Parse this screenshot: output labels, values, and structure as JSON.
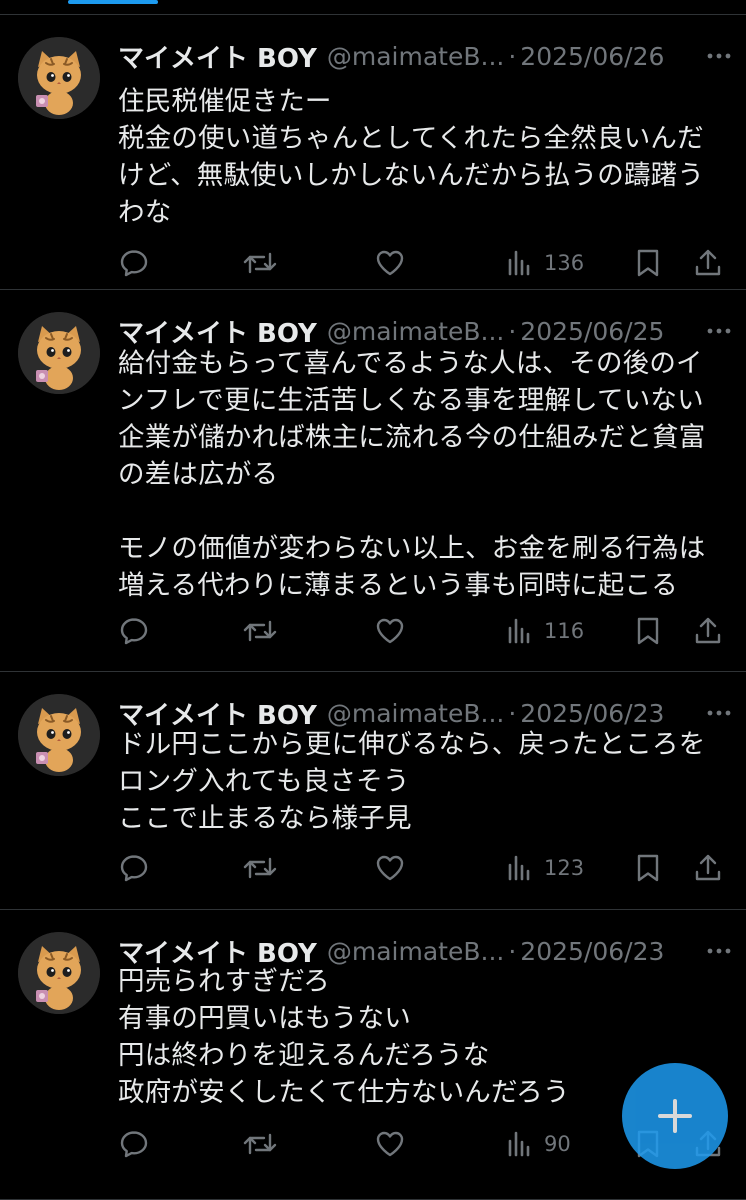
{
  "tweets": [
    {
      "name": "マイメイト BOY",
      "handle": "@maimateB...",
      "separator": "·",
      "date": "2025/06/26",
      "lines": [
        "住民税催促きたー",
        "税金の使い道ちゃんとしてくれたら全然良いんだ",
        "けど、無駄使いしかしないんだから払うの躊躇う",
        "わな"
      ],
      "views": "136"
    },
    {
      "name": "マイメイト BOY",
      "handle": "@maimateB...",
      "separator": "·",
      "date": "2025/06/25",
      "lines": [
        "給付金もらって喜んでるような人は、その後のイ",
        "ンフレで更に生活苦しくなる事を理解していない",
        "企業が儲かれば株主に流れる今の仕組みだと貧富",
        "の差は広がる",
        "",
        "モノの価値が変わらない以上、お金を刷る行為は",
        "増える代わりに薄まるという事も同時に起こる"
      ],
      "views": "116"
    },
    {
      "name": "マイメイト BOY",
      "handle": "@maimateB...",
      "separator": "·",
      "date": "2025/06/23",
      "lines": [
        "ドル円ここから更に伸びるなら、戻ったところを",
        "ロング入れても良さそう",
        "ここで止まるなら様子見"
      ],
      "views": "123"
    },
    {
      "name": "マイメイト BOY",
      "handle": "@maimateB...",
      "separator": "·",
      "date": "2025/06/23",
      "lines": [
        "円売られすぎだろ",
        "有事の円買いはもうない",
        "円は終わりを迎えるんだろうな",
        "政府が安くしたくて仕方ないんだろう"
      ],
      "views": "90"
    }
  ],
  "colors": {
    "background": "#000000",
    "text": "#e7e9ea",
    "muted": "#71767b",
    "accent": "#1d9bf0",
    "divider": "#2f3336"
  },
  "icons": [
    "more-icon",
    "reply-icon",
    "repost-icon",
    "like-icon",
    "views-icon",
    "bookmark-icon",
    "share-icon",
    "compose-plus-icon"
  ]
}
